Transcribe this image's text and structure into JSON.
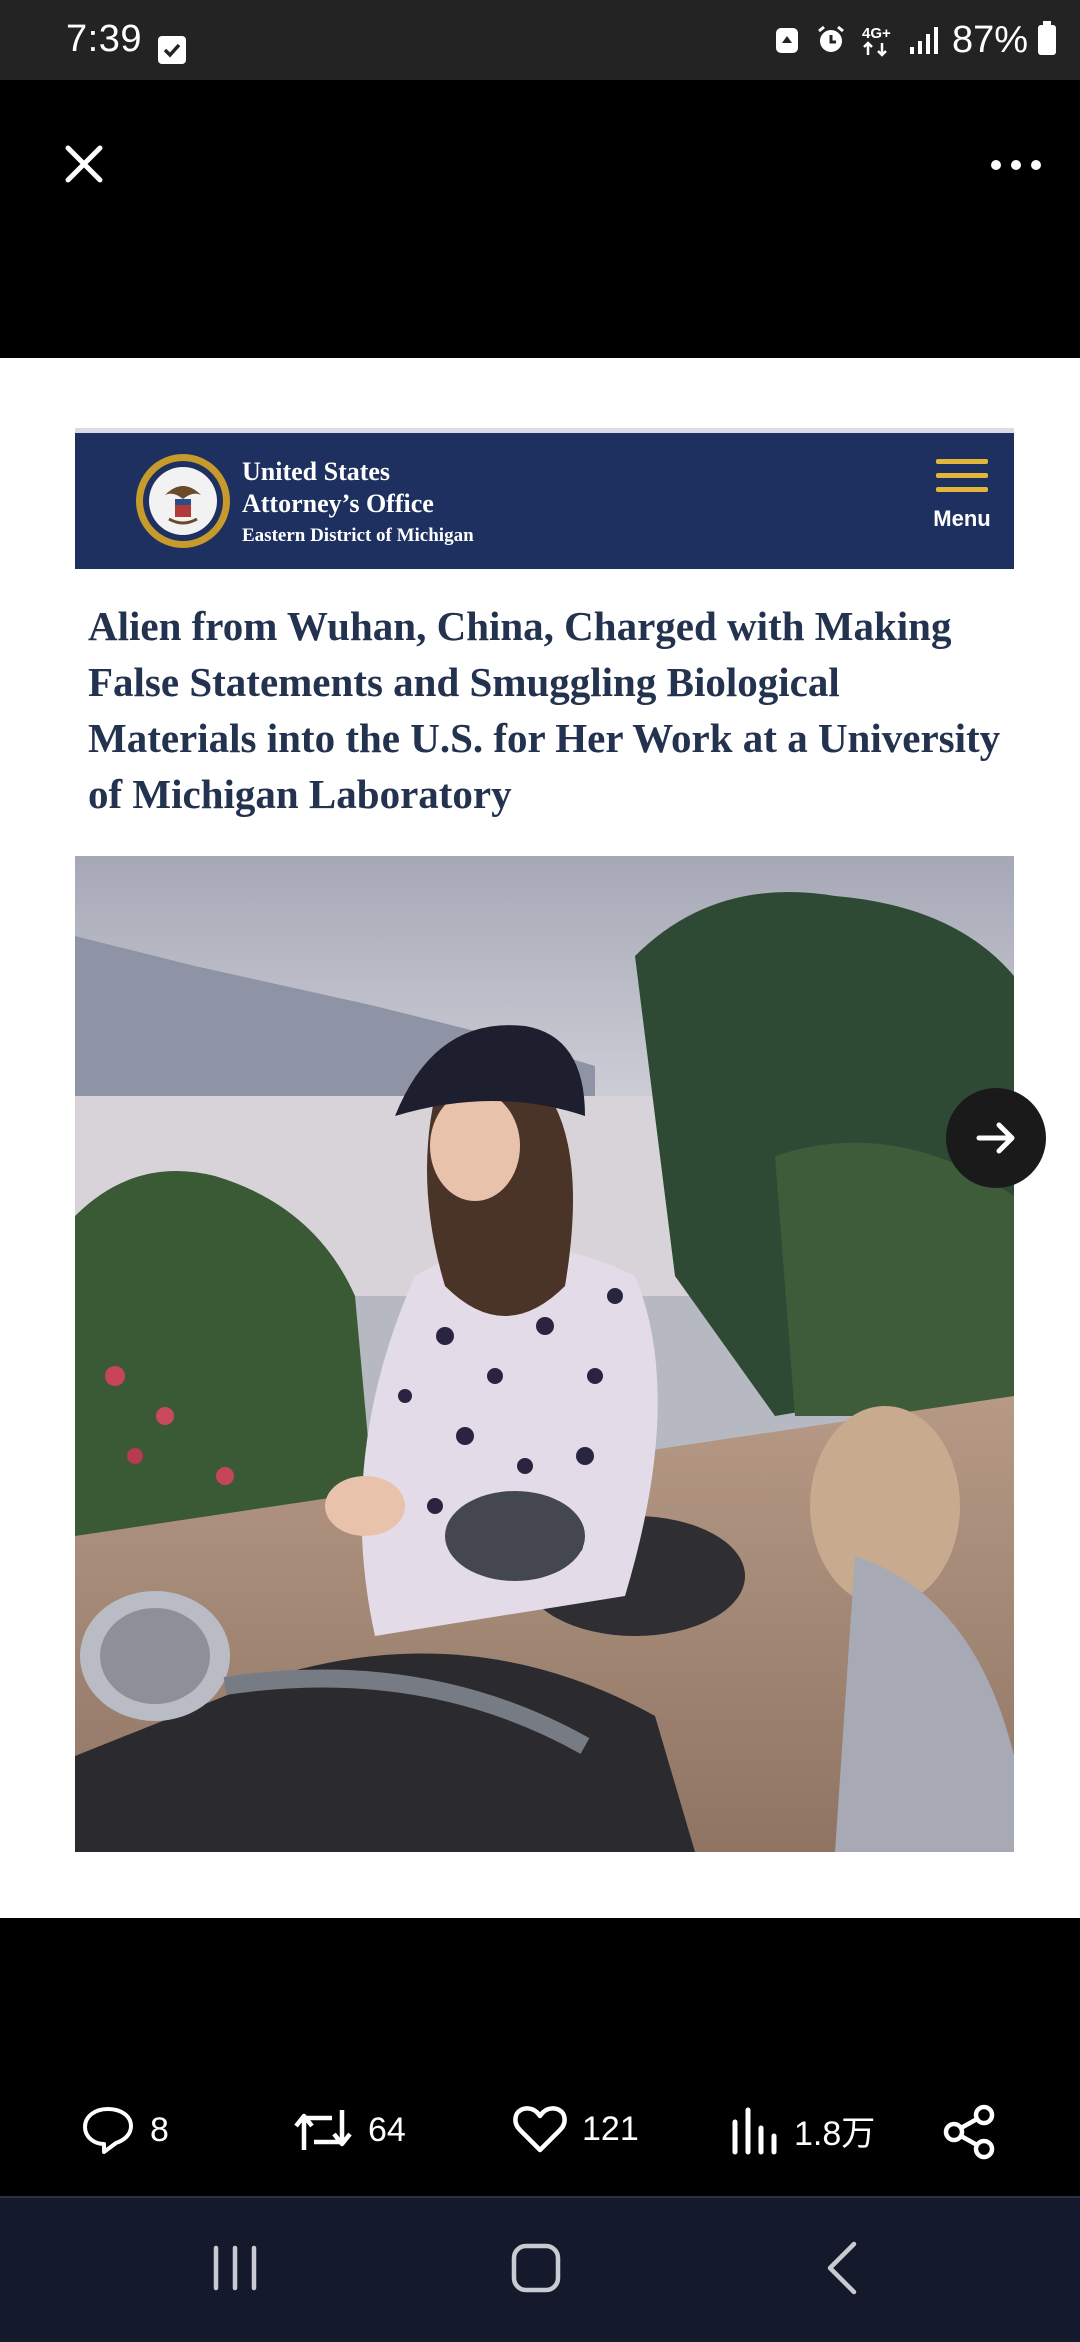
{
  "status_bar": {
    "time": "7:39",
    "network": "4G+",
    "battery": "87%",
    "icons": [
      "checkbox-icon",
      "recycle-icon",
      "alarm-icon",
      "network-icon",
      "signal-icon",
      "battery-icon"
    ]
  },
  "viewer": {
    "close_icon": "close-icon",
    "more_icon": "more-horizontal-icon"
  },
  "article": {
    "org_line1": "United States",
    "org_line2": "Attorney’s Office",
    "org_line3": "Eastern District of Michigan",
    "menu_label": "Menu",
    "headline": "Alien from Wuhan, China, Charged with Making False Statements and Smuggling Biological Materials into the U.S. for Her Work at a University of Michigan Laboratory"
  },
  "actions": {
    "replies": "8",
    "reposts": "64",
    "likes": "121",
    "views": "1.8万"
  },
  "colors": {
    "header_navy": "#1e3060",
    "menu_gold": "#e3b53b",
    "headline_text": "#23324f",
    "nav_bar": "#141a2b"
  }
}
